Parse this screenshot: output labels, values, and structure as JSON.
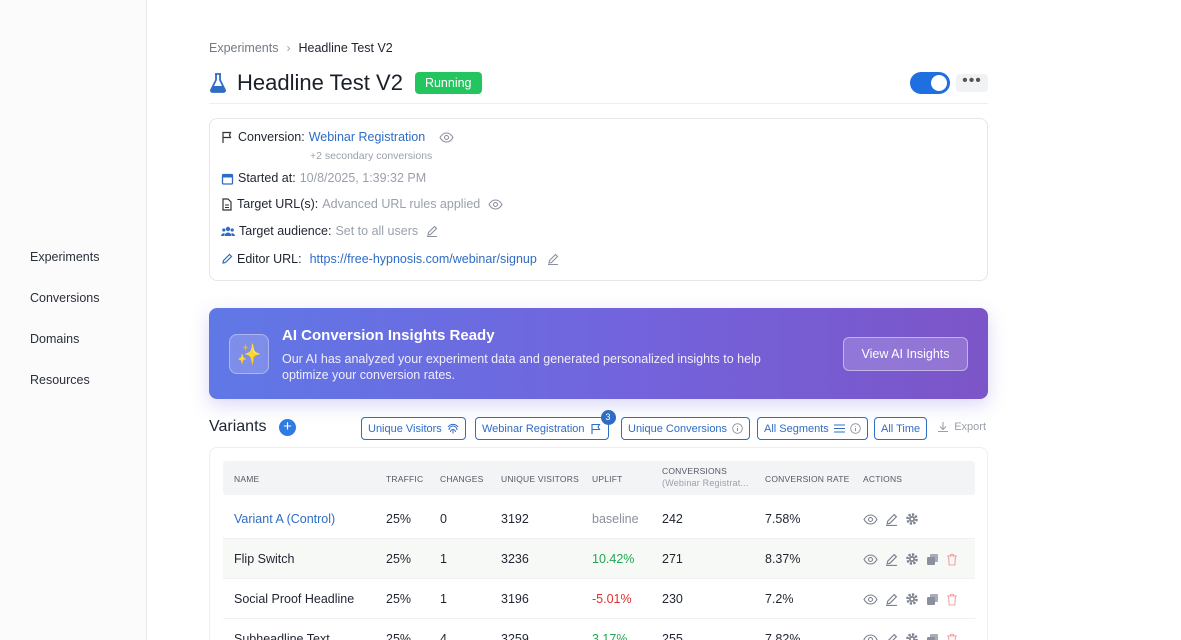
{
  "sidebar": {
    "items": [
      {
        "label": "Experiments"
      },
      {
        "label": "Conversions"
      },
      {
        "label": "Domains"
      },
      {
        "label": "Resources"
      }
    ]
  },
  "breadcrumb": {
    "parent": "Experiments",
    "current": "Headline Test V2"
  },
  "header": {
    "title": "Headline Test V2",
    "status": "Running",
    "enabled": true,
    "colors": {
      "status": "#22c55e",
      "toggle": "#1f6fe0"
    }
  },
  "info": {
    "conversion_label": "Conversion:",
    "conversion_value": "Webinar Registration",
    "conversion_note": "+2 secondary conversions",
    "started_label": "Started at:",
    "started_value": "10/8/2025, 1:39:32 PM",
    "url_label": "Target URL(s):",
    "url_value": "Advanced URL rules applied",
    "audience_label": "Target audience:",
    "audience_value": "Set to all users",
    "editor_label": "Editor URL:",
    "editor_value": "https://free-hypnosis.com/webinar/signup"
  },
  "ai_banner": {
    "icon": "sparkles-icon",
    "title": "AI Conversion Insights Ready",
    "description": "Our AI has analyzed your experiment data and generated personalized insights to help optimize your conversion rates.",
    "button": "View AI Insights"
  },
  "variants": {
    "title": "Variants",
    "filters": {
      "visitors": "Unique Visitors",
      "conversion": "Webinar Registration",
      "conversion_count": "3",
      "conversions": "Unique Conversions",
      "segments": "All Segments",
      "time": "All Time"
    },
    "export": "Export",
    "columns": {
      "name": "Name",
      "traffic": "Traffic",
      "changes": "Changes",
      "visitors": "Unique Visitors",
      "uplift": "Uplift",
      "conversions": "Conversions",
      "conversions_sub": "(Webinar Registrat...",
      "rate": "Conversion Rate",
      "actions": "Actions"
    },
    "rows": [
      {
        "name": "Variant A (Control)",
        "traffic": "25%",
        "changes": "0",
        "visitors": "3192",
        "uplift": "baseline",
        "conversions": "242",
        "rate": "7.58%"
      },
      {
        "name": "Flip Switch",
        "traffic": "25%",
        "changes": "1",
        "visitors": "3236",
        "uplift": "10.42%",
        "conversions": "271",
        "rate": "8.37%"
      },
      {
        "name": "Social Proof Headline",
        "traffic": "25%",
        "changes": "1",
        "visitors": "3196",
        "uplift": "-5.01%",
        "conversions": "230",
        "rate": "7.2%"
      },
      {
        "name": "Subheadline Text",
        "traffic": "25%",
        "changes": "4",
        "visitors": "3259",
        "uplift": "3.17%",
        "conversions": "255",
        "rate": "7.82%"
      }
    ]
  }
}
